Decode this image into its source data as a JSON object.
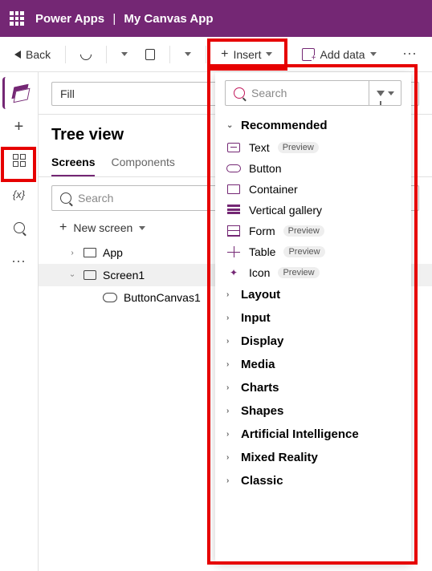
{
  "topbar": {
    "app": "Power Apps",
    "title": "My Canvas App"
  },
  "toolbar": {
    "back": "Back",
    "insert": "Insert",
    "add_data": "Add data"
  },
  "fill_select": {
    "label": "Fill"
  },
  "tree": {
    "title": "Tree view",
    "tabs": {
      "screens": "Screens",
      "components": "Components"
    },
    "search_placeholder": "Search",
    "new_screen": "New screen",
    "nodes": {
      "app": "App",
      "screen1": "Screen1",
      "button": "ButtonCanvas1"
    }
  },
  "insert_panel": {
    "search_placeholder": "Search",
    "recommended_label": "Recommended",
    "items": {
      "text": "Text",
      "button": "Button",
      "container": "Container",
      "vgallery": "Vertical gallery",
      "form": "Form",
      "table": "Table",
      "icon": "Icon"
    },
    "preview_badge": "Preview",
    "categories": {
      "layout": "Layout",
      "input": "Input",
      "display": "Display",
      "media": "Media",
      "charts": "Charts",
      "shapes": "Shapes",
      "ai": "Artificial Intelligence",
      "mr": "Mixed Reality",
      "classic": "Classic"
    }
  }
}
